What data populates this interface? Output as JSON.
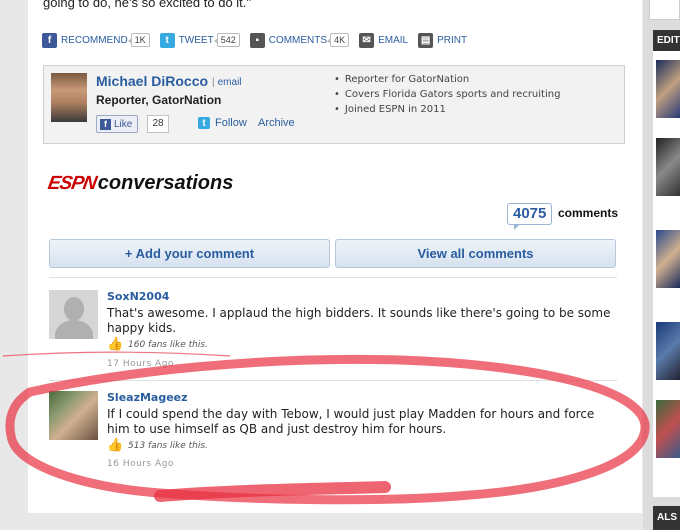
{
  "article": {
    "quote_tail": "going to do, he's so excited to do it.\""
  },
  "share_bar": {
    "recommend_label": "RECOMMEND",
    "recommend_count": "1K",
    "tweet_label": "TWEET",
    "tweet_count": "542",
    "comments_label": "COMMENTS",
    "comments_count": "4K",
    "email_label": "EMAIL",
    "print_label": "PRINT"
  },
  "author": {
    "name": "Michael DiRocco",
    "email_label": "email",
    "role": "Reporter, GatorNation",
    "like_label": "Like",
    "like_count": "28",
    "follow_label": "Follow",
    "archive_label": "Archive",
    "facts": [
      "Reporter for GatorNation",
      "Covers Florida Gators sports and recruiting",
      "Joined ESPN in 2011"
    ]
  },
  "conversations": {
    "logo_espn": "ESPN",
    "logo_word": "conversations",
    "count": "4075",
    "count_label": "comments",
    "add_comment_label": "+ Add your comment",
    "view_all_label": "View all comments"
  },
  "comments": [
    {
      "user": "SoxN2004",
      "text": "That's awesome. I applaud the high bidders. It sounds like there's going to be some happy kids.",
      "likes": "160 fans like this.",
      "time": "17 Hours Ago"
    },
    {
      "user": "SleazMageez",
      "text": "If I could spend the day with Tebow, I would just play Madden for hours and force him to use himself as QB and just destroy him for hours.",
      "likes": "513 fans like this.",
      "time": "16 Hours Ago"
    }
  ],
  "right_column": {
    "header_top": "EDIT",
    "header_bottom": "ALS"
  },
  "colors": {
    "link_blue": "#2a5d9f",
    "espn_red": "#cc0000",
    "annotation_red": "#e83040"
  },
  "icons": {
    "recommend": "facebook-icon",
    "tweet": "twitter-icon",
    "comments": "comment-bubble-icon",
    "email": "envelope-icon",
    "print": "printer-icon",
    "like": "thumbs-up-icon"
  }
}
